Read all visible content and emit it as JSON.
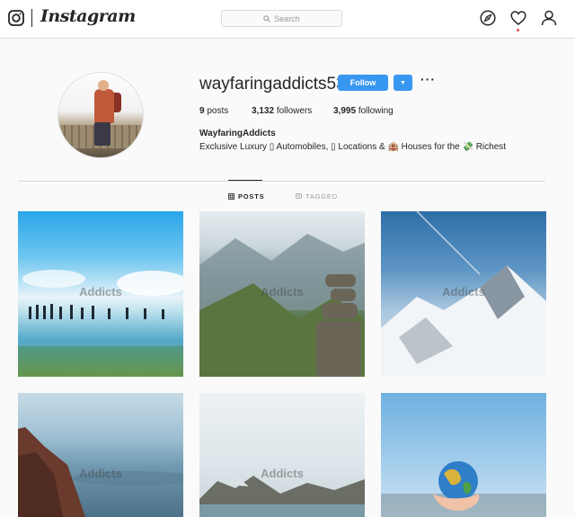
{
  "header": {
    "logo_text": "Instagram",
    "search_placeholder": "Search",
    "icons": [
      "instagram-glyph-icon",
      "search-icon",
      "compass-icon",
      "heart-icon",
      "profile-icon"
    ],
    "accent": "#3897f0",
    "notification_dot_color": "#ed4956"
  },
  "profile": {
    "username": "wayfaringaddicts53",
    "follow_label": "Follow",
    "dropdown_glyph": "▼",
    "more_glyph": "···",
    "stats": {
      "posts_count": "9",
      "posts_label": "posts",
      "followers_count": "3,132",
      "followers_label": "followers",
      "following_count": "3,995",
      "following_label": "following"
    },
    "full_name": "WayfaringAddicts",
    "bio": "Exclusive Luxury ▯ Automobiles, ▯ Locations & 🏨 Houses for the 💸 Richest"
  },
  "tabs": [
    {
      "label": "POSTS",
      "active": true,
      "icon": "grid-icon"
    },
    {
      "label": "TAGGED",
      "active": false,
      "icon": "tag-icon"
    }
  ],
  "posts": [
    {
      "watermark": "Addicts",
      "scene": "people walking on reflective lake under blue sky"
    },
    {
      "watermark": "Addicts",
      "scene": "mountain valley with stacked rock cairn"
    },
    {
      "watermark": "Addicts",
      "scene": "snowy mountain peaks"
    },
    {
      "watermark": "Addicts",
      "scene": "person overlooking hazy blue landscape"
    },
    {
      "watermark": "Addicts",
      "scene": "mountains over lake under pale sky"
    },
    {
      "watermark": "",
      "scene": "hand holding a globe against sky"
    }
  ]
}
